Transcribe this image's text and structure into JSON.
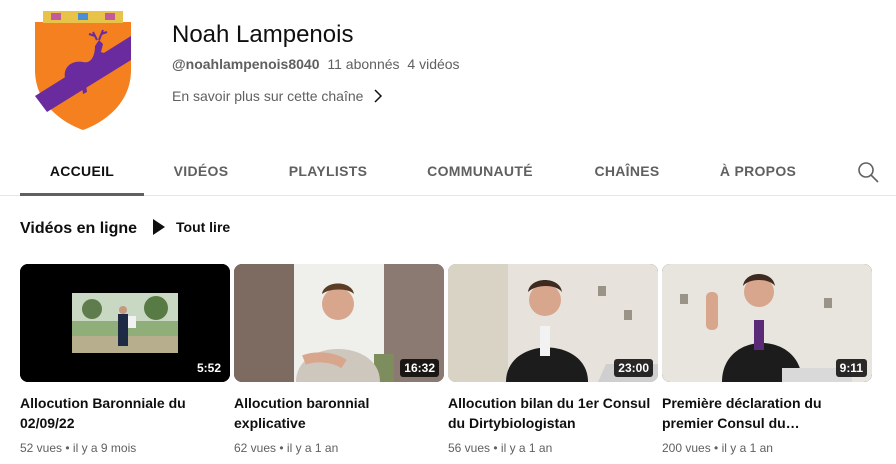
{
  "channel": {
    "name": "Noah Lampenois",
    "handle": "@noahlampenois8040",
    "subscribers": "11 abonnés",
    "video_count": "4 vidéos",
    "more_link": "En savoir plus sur cette chaîne",
    "avatar_colors": {
      "shield": "#f4801f",
      "band": "#6a2b9e",
      "crown": "#e8c34a"
    }
  },
  "tabs": [
    {
      "label": "ACCUEIL",
      "active": true
    },
    {
      "label": "VIDÉOS"
    },
    {
      "label": "PLAYLISTS"
    },
    {
      "label": "COMMUNAUTÉ"
    },
    {
      "label": "CHAÎNES"
    },
    {
      "label": "À PROPOS"
    }
  ],
  "section": {
    "title": "Vidéos en ligne",
    "play_all": "Tout lire"
  },
  "videos": [
    {
      "title": "Allocution Baronniale du 02/09/22",
      "views": "52 vues",
      "age": "il y a 9 mois",
      "duration": "5:52"
    },
    {
      "title": "Allocution baronnial explicative",
      "views": "62 vues",
      "age": "il y a 1 an",
      "duration": "16:32"
    },
    {
      "title": "Allocution bilan du 1er Consul du Dirtybiologistan",
      "views": "56 vues",
      "age": "il y a 1 an",
      "duration": "23:00"
    },
    {
      "title": "Première déclaration du premier Consul du…",
      "views": "200 vues",
      "age": "il y a 1 an",
      "duration": "9:11"
    }
  ],
  "icons": {
    "search": "search-icon",
    "chevron": "chevron-right-icon",
    "play": "play-icon"
  }
}
